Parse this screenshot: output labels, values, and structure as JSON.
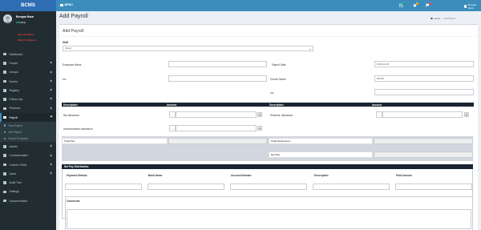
{
  "app": {
    "logo": "BCMS",
    "menu_toggle": "MENU",
    "brand_color": "#3c8dbc",
    "sidebar_color": "#222d32"
  },
  "topbar": {
    "mail_badge": "0",
    "bell_badge": "0",
    "flag_badge": "0",
    "user_name": "Bongaa Naza"
  },
  "sidebar": {
    "user_name": "Bongaa Naza",
    "user_status": "Online",
    "alert_line1": "Sex still flame",
    "alert_line2": "Click To View As",
    "items": [
      {
        "label": "Dashboard",
        "icon": "dashboard-icon"
      },
      {
        "label": "People",
        "icon": "user-icon"
      },
      {
        "label": "Groups",
        "icon": "users-icon"
      },
      {
        "label": "Events",
        "icon": "calendar-icon"
      },
      {
        "label": "Registry",
        "icon": "book-icon"
      },
      {
        "label": "Follow Ups",
        "icon": "phone-icon"
      },
      {
        "label": "Finances",
        "icon": "money-icon"
      },
      {
        "label": "Payroll",
        "icon": "file-icon"
      }
    ],
    "payroll_sub": [
      "View Payroll",
      "Add Payroll",
      "Payroll Templates"
    ],
    "items_after": [
      {
        "label": "Assets",
        "icon": "cube-icon"
      },
      {
        "label": "Communication",
        "icon": "envelope-icon"
      },
      {
        "label": "Custom Fields",
        "icon": "sliders-icon"
      },
      {
        "label": "Users",
        "icon": "user-shield-icon"
      },
      {
        "label": "Audit Trail",
        "icon": "history-icon"
      },
      {
        "label": "Settings",
        "icon": "gear-icon"
      },
      {
        "label": "Documentation",
        "icon": "doc-icon"
      }
    ]
  },
  "page": {
    "title": "Add Payroll",
    "breadcrumb_home": "Home",
    "breadcrumb_current": "Add Payroll"
  },
  "form": {
    "box_title": "Add Payroll",
    "staff_label": "Staff",
    "staff_selected": "Select",
    "employee_name_label": "Employee Name",
    "payroll_date_label": "Payroll Date",
    "payroll_date_value": "2019-12-23",
    "nrc_label": "nrc",
    "church_name_label": "Church Name",
    "church_name_value": "BCMS",
    "nrc2_label": "nrc"
  },
  "earnings": {
    "col_desc": "Description",
    "col_amount": "Amount",
    "row1_label": "kitu allowance",
    "row2_label": "communication allowance",
    "total_label": "Total Pay",
    "dash": "-"
  },
  "deductions": {
    "col_desc": "Description",
    "col_amount": "Amount",
    "row1_label": "Sections: allowance",
    "total_label": "Total Deductions",
    "net_label": "Net Pay",
    "dash": "-"
  },
  "distribution": {
    "header": "Net Pay Distribution",
    "columns": [
      "Payment Method",
      "Bank Name",
      "Account Number",
      "Description",
      "Paid Amount"
    ]
  },
  "comments": {
    "label": "Comments"
  }
}
